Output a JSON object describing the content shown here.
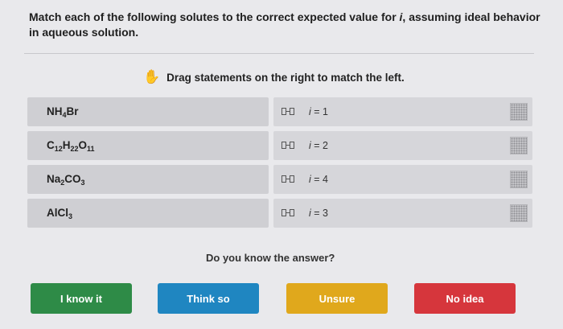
{
  "question": "Match each of the following solutes to the correct expected value for i, assuming ideal behavior in aqueous solution.",
  "question_parts": {
    "before": "Match each of the following solutes to the correct expected value for ",
    "var": "i",
    "after": ", assuming ideal behavior in aqueous solution."
  },
  "instruction": "Drag statements on the right to match the left.",
  "left_items": [
    {
      "label": "NH4Br"
    },
    {
      "label": "C12H22O11"
    },
    {
      "label": "Na2CO3"
    },
    {
      "label": "AlCl3"
    }
  ],
  "right_items": [
    {
      "var": "i",
      "rest": " = 1"
    },
    {
      "var": "i",
      "rest": " = 2"
    },
    {
      "var": "i",
      "rest": " = 4"
    },
    {
      "var": "i",
      "rest": " = 3"
    }
  ],
  "prompt": "Do you know the answer?",
  "buttons": {
    "know": {
      "label": "I know it",
      "color": "#2e8b47"
    },
    "think": {
      "label": "Think so",
      "color": "#1f86c1"
    },
    "unsure": {
      "label": "Unsure",
      "color": "#e0a81c"
    },
    "noidea": {
      "label": "No idea",
      "color": "#d6363c"
    }
  },
  "icons": {
    "hand": "hand-icon",
    "drag": "drag-handle-icon",
    "grip": "grip-icon"
  }
}
